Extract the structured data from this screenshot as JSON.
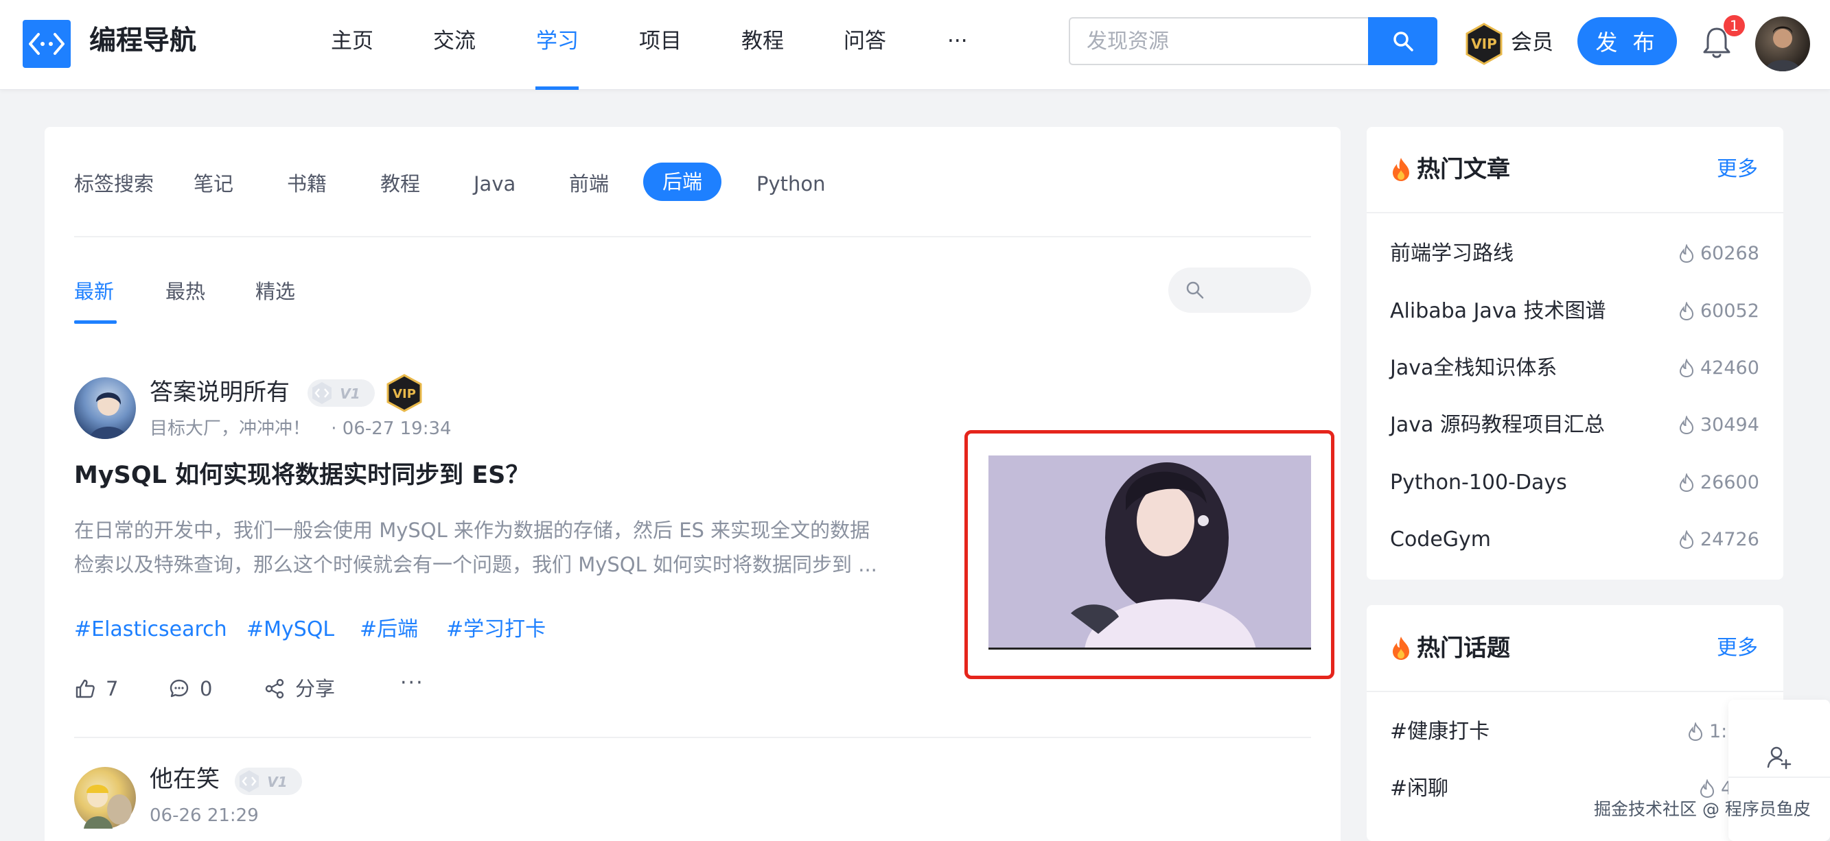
{
  "header": {
    "site_name": "编程导航",
    "nav": [
      "主页",
      "交流",
      "学习",
      "项目",
      "教程",
      "问答",
      "···"
    ],
    "active_nav": "学习",
    "search_placeholder": "发现资源",
    "vip_label": "会员",
    "publish_label": "发 布",
    "notification_count": "1"
  },
  "tags": {
    "label": "标签搜索",
    "items": [
      "笔记",
      "书籍",
      "教程",
      "Java",
      "前端",
      "后端",
      "Python"
    ],
    "active": "后端"
  },
  "sort_tabs": [
    "最新",
    "最热",
    "精选"
  ],
  "articles": [
    {
      "author": "答案说明所有",
      "level": "V1",
      "bio": "目标大厂，冲冲冲！",
      "time": "· 06-27 19:34",
      "title": "MySQL 如何实现将数据实时同步到 ES？",
      "abstract_line1": "在日常的开发中，我们一般会使用 MySQL 来作为数据的存储，然后 ES 来实现全文的数据",
      "abstract_line2": "检索以及特殊查询，那么这个时候就会有一个问题，我们 MySQL 如何实时将数据同步到 ...",
      "hashtags": [
        "#Elasticsearch",
        "#MySQL",
        "#后端",
        "#学习打卡"
      ],
      "likes": "7",
      "comments": "0",
      "share_label": "分享",
      "more": "···"
    },
    {
      "author": "他在笑",
      "level": "V1",
      "time": "06-26 21:29"
    }
  ],
  "sidebar": {
    "hot_articles": {
      "title": "热门文章",
      "more": "更多",
      "items": [
        {
          "name": "前端学习路线",
          "count": "60268"
        },
        {
          "name": "Alibaba Java 技术图谱",
          "count": "60052"
        },
        {
          "name": "Java全栈知识体系",
          "count": "42460"
        },
        {
          "name": "Java 源码教程项目汇总",
          "count": "30494"
        },
        {
          "name": "Python-100-Days",
          "count": "26600"
        },
        {
          "name": "CodeGym",
          "count": "24726"
        }
      ]
    },
    "hot_topics": {
      "title": "热门话题",
      "more": "更多",
      "items": [
        {
          "name": "#健康打卡",
          "count": "1:"
        },
        {
          "name": "#闲聊",
          "count": "4"
        }
      ]
    }
  },
  "watermark": "掘金技术社区 @ 程序员鱼皮",
  "colors": {
    "accent": "#1e80ff",
    "highlight": "#e5251c",
    "background": "#f2f3f5"
  }
}
